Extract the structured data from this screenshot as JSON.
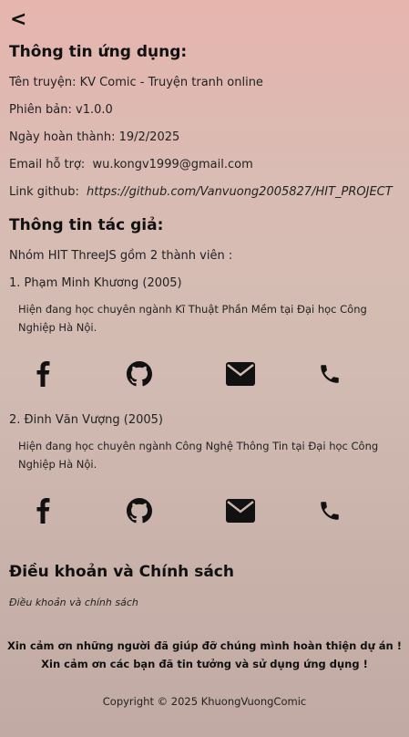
{
  "nav": {
    "back_label": "<"
  },
  "app_info": {
    "title": "Thông tin ứng dụng:",
    "name_label": "Tên truyện:",
    "name_value": "KV Comic - Truyện tranh online",
    "version_label": "Phiên bản:",
    "version_value": "v1.0.0",
    "date_label": "Ngày hoàn thành:",
    "date_value": "19/2/2025",
    "email_label": "Email hỗ trợ:",
    "email_value": "wu.kongv1999@gmail.com",
    "github_label": "Link github:",
    "github_value": "https://github.com/Vanvuong2005827/HIT_PROJECT"
  },
  "author_info": {
    "title": "Thông tin tác giả:",
    "group_text": "Nhóm HIT ThreeJS gồm 2 thành viên :",
    "members": [
      {
        "name": "1. Phạm Minh Khương (2005)",
        "desc": "Hiện đang học chuyên ngành Kĩ Thuật Phần Mềm tại Đại học Công Nghiệp Hà Nội."
      },
      {
        "name": "2. Đinh Văn Vượng (2005)",
        "desc": "Hiện đang học chuyên ngành Công Nghệ Thông Tin tại Đại học Công Nghiệp Hà Nội."
      }
    ],
    "icons": [
      "facebook-icon",
      "github-icon",
      "mail-icon",
      "phone-icon"
    ]
  },
  "policy": {
    "title": "Điều khoản và Chính sách",
    "link": "Điều khoản và chính sách"
  },
  "footer": {
    "thanks_1": "Xin cảm ơn những người đã giúp đỡ chúng mình hoàn thiện dự án !",
    "thanks_2": "Xin cảm ơn các bạn đã tin tưởng và sử dụng ứng dụng !",
    "copyright": "Copyright © 2025 KhuongVuongComic"
  },
  "colors": {
    "background_top": "#e6b5ae",
    "background_bottom": "#c0aaa3",
    "text": "#111111"
  }
}
